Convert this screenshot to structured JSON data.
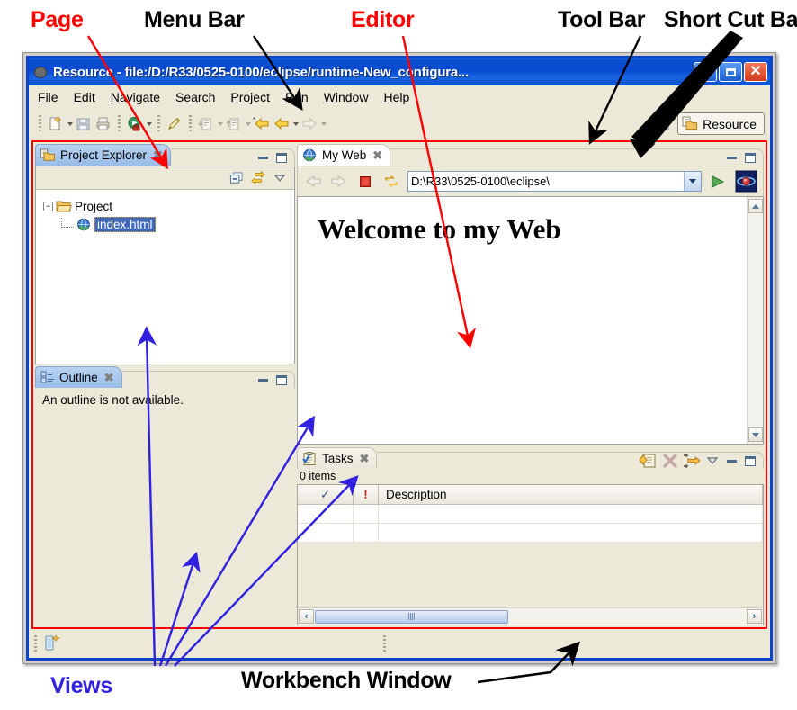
{
  "annotations": {
    "page": "Page",
    "menu_bar": "Menu Bar",
    "editor": "Editor",
    "tool_bar": "Tool Bar",
    "short_cut_bar": "Short Cut Bar",
    "views": "Views",
    "workbench_window": "Workbench Window",
    "colors": {
      "red": "#ff0000",
      "black": "#000000",
      "blue": "#3020e0"
    }
  },
  "window": {
    "title": "Resource - file:/D:/R33/0525-0100/eclipse/runtime-New_configura...",
    "title_icon": "eclipse-globe-icon",
    "buttons": {
      "minimize": "Minimize",
      "maximize": "Maximize",
      "close": "Close"
    },
    "titlebar_color": "#0a4ad3"
  },
  "menubar": {
    "items": [
      {
        "label": "File",
        "pre": "",
        "mnemonic": "F",
        "post": "ile"
      },
      {
        "label": "Edit",
        "pre": "",
        "mnemonic": "E",
        "post": "dit"
      },
      {
        "label": "Navigate",
        "pre": "",
        "mnemonic": "N",
        "post": "avigate"
      },
      {
        "label": "Search",
        "pre": "Se",
        "mnemonic": "a",
        "post": "rch"
      },
      {
        "label": "Project",
        "pre": "",
        "mnemonic": "P",
        "post": "roject"
      },
      {
        "label": "Run",
        "pre": "",
        "mnemonic": "R",
        "post": "un"
      },
      {
        "label": "Window",
        "pre": "",
        "mnemonic": "W",
        "post": "indow"
      },
      {
        "label": "Help",
        "pre": "",
        "mnemonic": "H",
        "post": "elp"
      }
    ]
  },
  "toolbar": {
    "buttons": [
      "new-wizard-icon",
      "save-icon",
      "print-icon",
      "run-icon",
      "external-tools-icon",
      "search-icon",
      "next-annotation-icon",
      "previous-annotation-icon",
      "back-to-icon",
      "backward-history-icon",
      "forward-history-icon"
    ],
    "perspective": {
      "open_perspective_icon": "open-perspective-icon",
      "label": "Resource",
      "icon": "resource-perspective-icon"
    }
  },
  "project_explorer": {
    "tab_label": "Project Explorer",
    "tab_icon": "project-explorer-icon",
    "close": "✖",
    "toolbar": [
      "collapse-all-icon",
      "link-with-editor-icon",
      "view-menu-icon"
    ],
    "minimize": "Minimize",
    "maximize": "Maximize",
    "tree": [
      {
        "label": "Project",
        "expander": "−",
        "icon": "folder-open-icon",
        "level": 0,
        "selected": false
      },
      {
        "label": "index.html",
        "expander": "",
        "icon": "html-globe-icon",
        "level": 1,
        "selected": true
      }
    ]
  },
  "outline": {
    "tab_label": "Outline",
    "tab_icon": "outline-icon",
    "close": "✖",
    "message": "An outline is not available.",
    "minimize": "Minimize",
    "maximize": "Maximize"
  },
  "editor": {
    "tab_label": "My Web",
    "tab_icon": "web-browser-icon",
    "close": "✖",
    "minimize": "Minimize",
    "maximize": "Maximize",
    "browser_toolbar": [
      "back-icon",
      "forward-icon",
      "stop-icon",
      "refresh-icon"
    ],
    "url": "D:\\R33\\0525-0100\\eclipse\\",
    "go_icon": "go-icon",
    "home_icon": "home-icon",
    "content_heading": "Welcome to my Web",
    "scroll_up": "▲",
    "scroll_down": "▼"
  },
  "tasks": {
    "tab_label": "Tasks",
    "tab_icon": "tasks-icon",
    "close": "✖",
    "toolbar": [
      "add-task-icon",
      "delete-task-icon",
      "filter-icon",
      "view-menu-icon"
    ],
    "minimize": "Minimize",
    "maximize": "Maximize",
    "item_count": "0 items",
    "columns": [
      "✓",
      "!",
      "Description"
    ],
    "rows": [],
    "empty_row_count": 2,
    "scroll_left": "‹",
    "scroll_right": "›"
  },
  "statusbar": {
    "icon": "progress-indicator-icon"
  }
}
